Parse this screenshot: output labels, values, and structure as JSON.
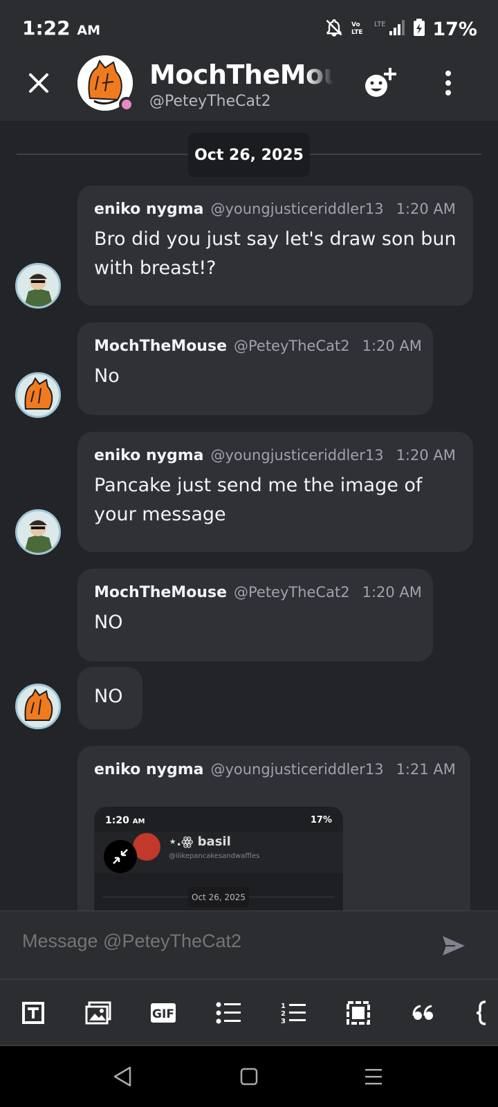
{
  "status_bar": {
    "time": "1:22",
    "ampm": "AM",
    "battery": "17%",
    "network": "LTE"
  },
  "header": {
    "name": "MochTheMouse",
    "handle": "@PeteyTheCat2",
    "presence_color": "#e78ac3"
  },
  "chat": {
    "date_divider": "Oct 26, 2025",
    "messages": [
      {
        "author": "eniko nygma",
        "handle": "@youngjusticeriddler13",
        "time": "1:20 AM",
        "text": "Bro did you just say let's draw son bun with breast!?"
      },
      {
        "author": "MochTheMouse",
        "handle": "@PeteyTheCat2",
        "time": "1:20 AM",
        "text": "No"
      },
      {
        "author": "eniko nygma",
        "handle": "@youngjusticeriddler13",
        "time": "1:20 AM",
        "text": "Pancake just send me the image of your message"
      },
      {
        "author": "MochTheMouse",
        "handle": "@PeteyTheCat2",
        "time": "1:20 AM",
        "text": "NO"
      },
      {
        "text": "NO"
      },
      {
        "author": "eniko nygma",
        "handle": "@youngjusticeriddler13",
        "time": "1:21 AM"
      }
    ],
    "embed": {
      "time": "1:20",
      "ampm": "AM",
      "battery": "17%",
      "name": "⋆.ꙮ basil",
      "handle": "@ilikepancakesandwaffles",
      "date": "Oct 26, 2025"
    }
  },
  "composer": {
    "placeholder": "Message @PeteyTheCat2"
  },
  "toolbar": {
    "gif_label": "GIF",
    "items": [
      "text-format-icon",
      "image-icon",
      "gif-icon",
      "bullet-list-icon",
      "numbered-list-icon",
      "spoiler-icon",
      "quote-icon",
      "code-block-icon"
    ]
  },
  "navbar": {
    "items": [
      "back-icon",
      "home-icon",
      "recents-icon"
    ]
  }
}
